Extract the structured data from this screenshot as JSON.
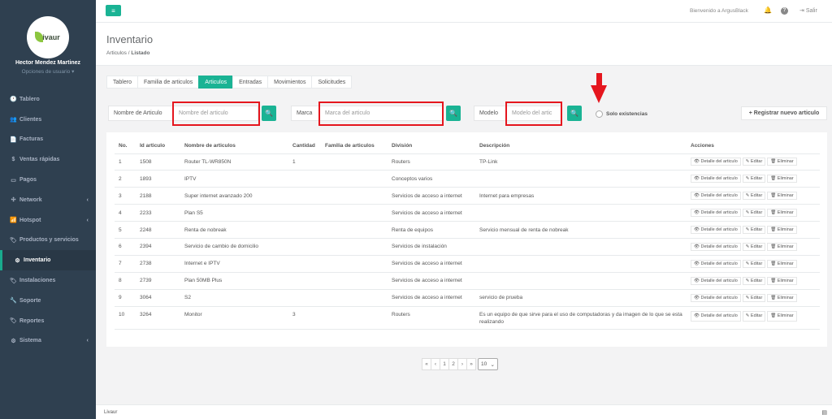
{
  "sidebar": {
    "logo_text": "ivaur",
    "profile_name": "Hector Mendez Martinez",
    "profile_options": "Opciones de usuario ▾",
    "items": [
      {
        "label": "Tablero",
        "icon": "🕐"
      },
      {
        "label": "Clientes",
        "icon": "👥"
      },
      {
        "label": "Facturas",
        "icon": "📄"
      },
      {
        "label": "Ventas rápidas",
        "icon": "$"
      },
      {
        "label": "Pagos",
        "icon": "▭"
      },
      {
        "label": "Network",
        "icon": "✣",
        "chevron": "‹"
      },
      {
        "label": "Hotspot",
        "icon": "📶",
        "chevron": "‹"
      },
      {
        "label": "Productos y servicios",
        "icon": "🏷"
      },
      {
        "label": "Inventario",
        "icon": "⚙"
      },
      {
        "label": "Instalaciones",
        "icon": "🏷"
      },
      {
        "label": "Soporte",
        "icon": "🔧"
      },
      {
        "label": "Reportes",
        "icon": "🏷"
      },
      {
        "label": "Sistema",
        "icon": "⚙",
        "chevron": "‹"
      }
    ]
  },
  "topbar": {
    "menu_icon": "≡",
    "welcome": "Bienvenido a ArgusBlack",
    "logout": "Salir"
  },
  "header": {
    "title": "Inventario",
    "breadcrumb_root": "Articulos",
    "breadcrumb_sep": " / ",
    "breadcrumb_active": "Listado"
  },
  "tabs": [
    "Tablero",
    "Familia de articulos",
    "Articulos",
    "Entradas",
    "Movimientos",
    "Solicitudes"
  ],
  "filters": {
    "name_label": "Nombre de Articulo",
    "name_placeholder": "Nombre del articulo",
    "brand_label": "Marca",
    "brand_placeholder": "Marca del articulo",
    "model_label": "Modelo",
    "model_placeholder": "Modelo del artic",
    "only_stock_label": "Solo existencias",
    "new_button": "+ Registrar nuevo articulo"
  },
  "table": {
    "headers": [
      "No.",
      "Id articulo",
      "Nombre de articulos",
      "Cantidad",
      "Familia de articulos",
      "División",
      "Descripción",
      "Acciones"
    ],
    "action_labels": {
      "detail": "👁 Detalle del articulo",
      "edit": "✎ Editar",
      "delete": "🗑 Eliminar"
    },
    "rows": [
      {
        "no": "1",
        "id": "1508",
        "name": "Router TL-WR850N",
        "qty": "1",
        "family": "",
        "division": "Routers",
        "desc": "TP-Link"
      },
      {
        "no": "2",
        "id": "1893",
        "name": "IPTV",
        "qty": "",
        "family": "",
        "division": "Conceptos varios",
        "desc": ""
      },
      {
        "no": "3",
        "id": "2188",
        "name": "Super internet avanzado 200",
        "qty": "",
        "family": "",
        "division": "Servicios de acceso a internet",
        "desc": "Internet para empresas"
      },
      {
        "no": "4",
        "id": "2233",
        "name": "Plan S5",
        "qty": "",
        "family": "",
        "division": "Servicios de acceso a internet",
        "desc": ""
      },
      {
        "no": "5",
        "id": "2248",
        "name": "Renta de nobreak",
        "qty": "",
        "family": "",
        "division": "Renta de equipos",
        "desc": "Servicio mensual de renta de nobreak"
      },
      {
        "no": "6",
        "id": "2394",
        "name": "Servicio de cambio de domicilio",
        "qty": "",
        "family": "",
        "division": "Servicios de instalación",
        "desc": ""
      },
      {
        "no": "7",
        "id": "2738",
        "name": "Internet e IPTV",
        "qty": "",
        "family": "",
        "division": "Servicios de acceso a internet",
        "desc": ""
      },
      {
        "no": "8",
        "id": "2739",
        "name": "Plan 50MB Plus",
        "qty": "",
        "family": "",
        "division": "Servicios de acceso a internet",
        "desc": ""
      },
      {
        "no": "9",
        "id": "3064",
        "name": "S2",
        "qty": "",
        "family": "",
        "division": "Servicios de acceso a internet",
        "desc": "servicio de prueba"
      },
      {
        "no": "10",
        "id": "3264",
        "name": "Monitor",
        "qty": "3",
        "family": "",
        "division": "Routers",
        "desc": "Es un equipo de que sirve para el uso de computadoras y da imagen de lo que se esta realizando"
      }
    ]
  },
  "pagination": {
    "first": "«",
    "prev": "‹",
    "pages": [
      "1",
      "2"
    ],
    "next": "›",
    "last": "»",
    "page_size": "10"
  },
  "footer": {
    "text": "Livaur"
  },
  "colors": {
    "accent": "#1ab394",
    "sidebar": "#2f4050",
    "highlight": "#e5161e"
  }
}
